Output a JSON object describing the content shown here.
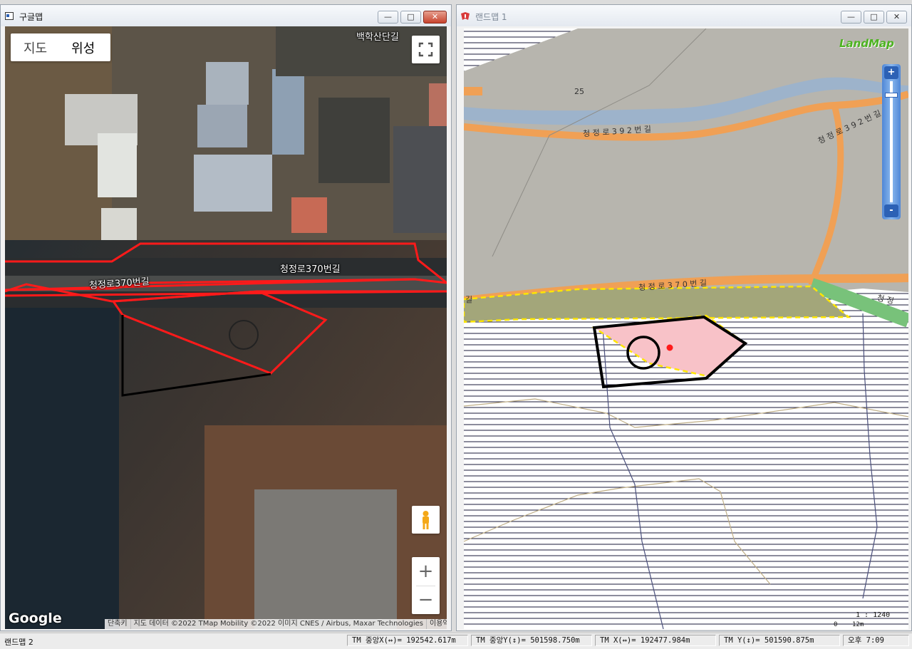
{
  "left_window": {
    "title": "구글맵",
    "map_type_toggle": {
      "map_label": "지도",
      "satellite_label": "위성"
    },
    "road_labels": {
      "top_right": "백학산단길",
      "road_left": "청정로370번길",
      "road_right": "청정로370번길"
    },
    "logo": "Google",
    "attribution": {
      "shortcuts": "단축키",
      "data": "지도 데이터 ©2022 TMap Mobility ©2022 이미지 CNES / Airbus, Maxar Technologies",
      "terms": "이용약관"
    },
    "icons": [
      "fullscreen-icon",
      "pegman-icon",
      "zoom-in-icon",
      "zoom-out-icon"
    ]
  },
  "right_window": {
    "title": "랜드맵 1",
    "logo": "LandMap",
    "labels": {
      "parcel_number": "25",
      "road_upper_left": "청 정 로 3 9 2 번 길",
      "road_upper_right": "청 정 로 3 9 2 번 길",
      "road_lower": "청 정 로 3 7 0 번 길",
      "road_lower_left": "길",
      "road_lower_right": "청 정"
    },
    "scale": {
      "ratio": "1 : 1240",
      "zero": "0",
      "distance": "12m"
    },
    "zoom_bar": {
      "plus": "+",
      "minus": "-"
    }
  },
  "window_buttons": {
    "minimize": "—",
    "maximize": "□",
    "close": "✕"
  },
  "statusbar": {
    "app_name": "랜드맵 2",
    "tm_center_x": "TM 중앙X(↔)= 192542.617m",
    "tm_center_y": "TM 중앙Y(↕)= 501598.750m",
    "tm_x": "TM X(↔)= 192477.984m",
    "tm_y": "TM Y(↕)= 501590.875m",
    "clock": "오후 7:09"
  },
  "colors": {
    "road_orange": "#f0a055",
    "river_blue": "#9fb5cc",
    "land_gray": "#b6b4ad",
    "parcel_pink": "#f8c2c8",
    "highlight_red": "#ff1a1a"
  }
}
